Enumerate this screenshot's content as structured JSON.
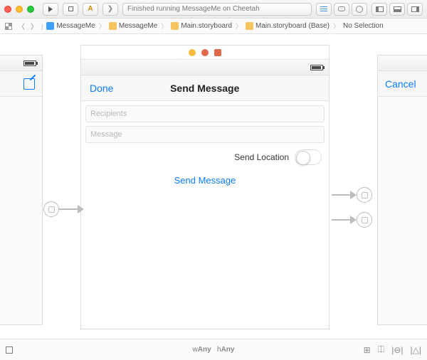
{
  "toolbar": {
    "status_text": "Finished running MessageMe on Cheetah",
    "scheme_letter": "A",
    "breakpoint_glyph": "❯"
  },
  "jump": {
    "crumbs": [
      "MessageMe",
      "MessageMe",
      "Main.storyboard",
      "Main.storyboard (Base)",
      "No Selection"
    ]
  },
  "scene_main": {
    "top_icons": [
      "sun",
      "cube",
      "square"
    ],
    "nav_left": "Done",
    "nav_title": "Send Message",
    "nav_right": "",
    "recipients_placeholder": "Recipients",
    "message_placeholder": "Message",
    "switch_label": "Send Location",
    "switch_on": false,
    "action_button": "Send Message"
  },
  "scene_right": {
    "nav_left": "Cancel"
  },
  "bottom": {
    "size_w_prefix": "w",
    "size_w": "Any",
    "size_h_prefix": "h",
    "size_h": "Any"
  }
}
